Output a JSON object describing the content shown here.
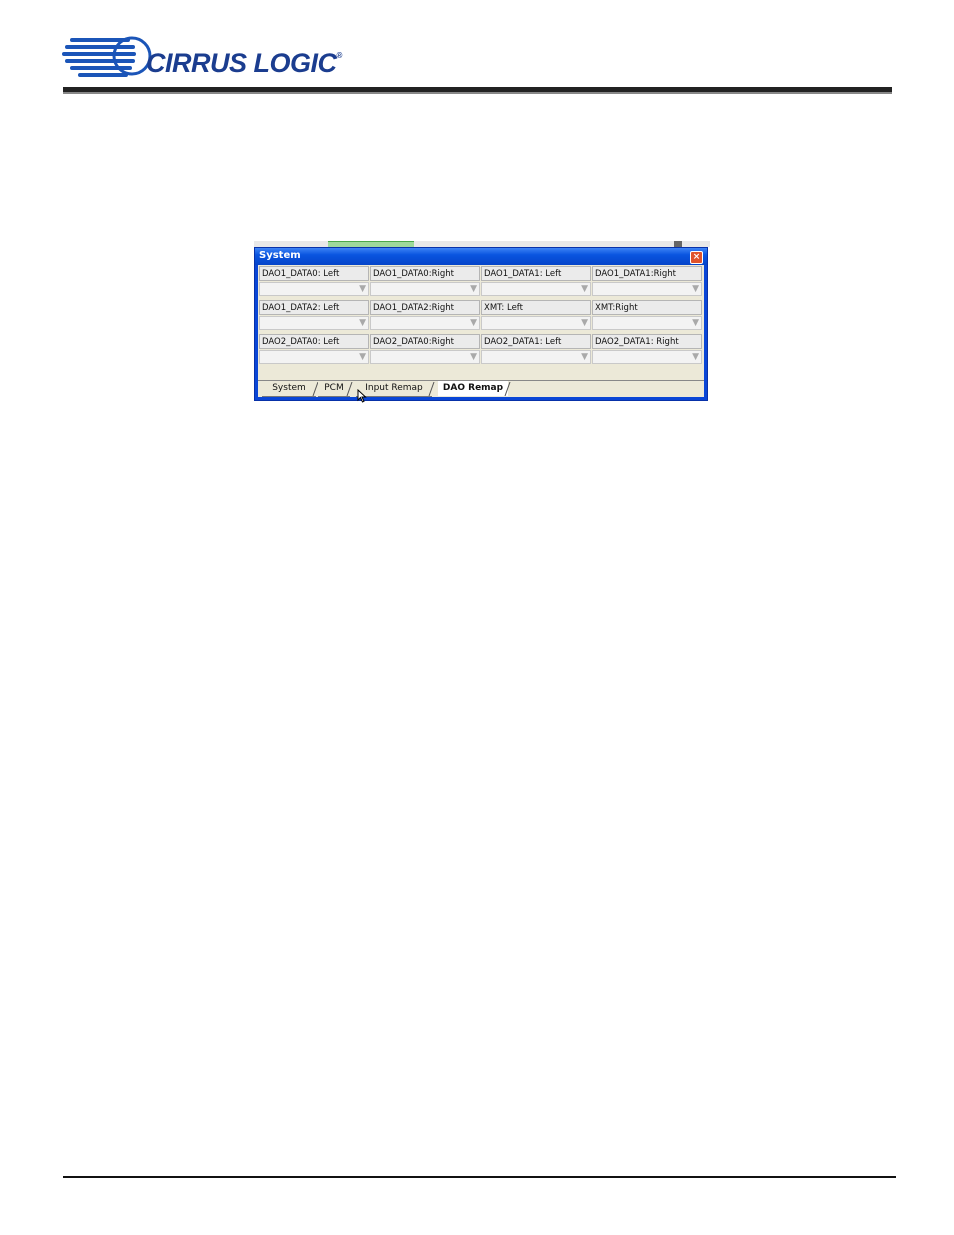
{
  "header": {
    "logo_text": "CIRRUS LOGIC",
    "logo_mark": "®"
  },
  "window": {
    "title": "System",
    "close_symbol": "×",
    "rows": [
      [
        "DAO1_DATA0: Left",
        "DAO1_DATA0:Right",
        "DAO1_DATA1: Left",
        "DAO1_DATA1:Right"
      ],
      [
        "DAO1_DATA2: Left",
        "DAO1_DATA2:Right",
        "XMT: Left",
        "XMT:Right"
      ],
      [
        "DAO2_DATA0: Left",
        "DAO2_DATA0:Right",
        "DAO2_DATA1: Left",
        "DAO2_DATA1: Right"
      ]
    ],
    "select_values": [
      "",
      "",
      "",
      "",
      "",
      "",
      "",
      "",
      "",
      "",
      "",
      ""
    ],
    "dropdown_arrow": "▼",
    "tabs": [
      "System",
      "PCM",
      "Input Remap",
      "DAO Remap"
    ],
    "active_tab": "DAO Remap"
  },
  "colors": {
    "titlebar": "#0a55e0",
    "client_bg": "#ece9d8",
    "logo_blue": "#1b3d8f"
  }
}
